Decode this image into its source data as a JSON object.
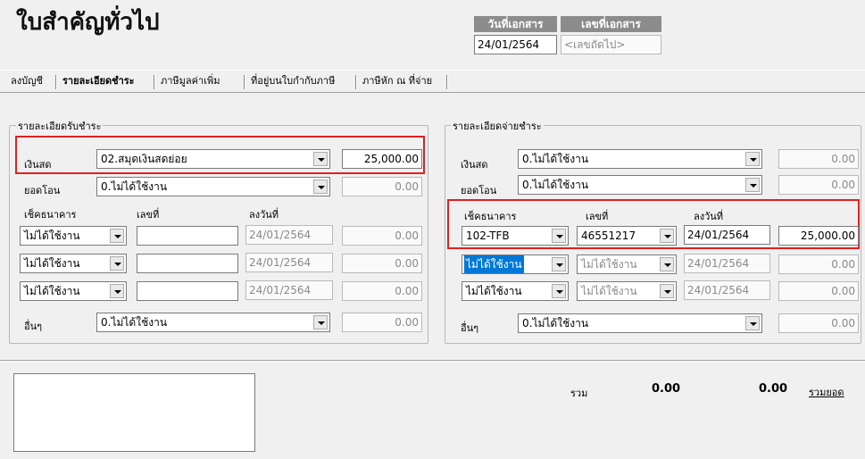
{
  "title": "ใบสำคัญทั่วไป",
  "doc": {
    "date_label": "วันที่เอกสาร",
    "no_label": "เลขที่เอกสาร",
    "date_value": "24/01/2564",
    "no_value": "<เลขถัดไป>"
  },
  "tabs": [
    "ลงบัญชี",
    "รายละเอียดชำระ",
    "ภาษีมูลค่าเพิ่ม",
    "ที่อยู่บนใบกำกับภาษี",
    "ภาษีหัก ณ ที่จ่าย"
  ],
  "receive": {
    "title": "รายละเอียดรับชำระ",
    "cash_label": "เงินสด",
    "cash_select": "02.สมุดเงินสดย่อย",
    "cash_amount": "25,000.00",
    "transfer_label": "ยอดโอน",
    "transfer_select": "0.ไม่ได้ใช้งาน",
    "transfer_amount": "0.00",
    "cheque_label": "เช็คธนาคาร",
    "no_label": "เลขที่",
    "date_label": "ลงวันที่",
    "cheques": [
      {
        "bank": "ไม่ได้ใช้งาน",
        "no": "",
        "date": "24/01/2564",
        "amount": "0.00"
      },
      {
        "bank": "ไม่ได้ใช้งาน",
        "no": "",
        "date": "24/01/2564",
        "amount": "0.00"
      },
      {
        "bank": "ไม่ได้ใช้งาน",
        "no": "",
        "date": "24/01/2564",
        "amount": "0.00"
      }
    ],
    "other_label": "อื่นๆ",
    "other_select": "0.ไม่ได้ใช้งาน",
    "other_amount": "0.00"
  },
  "pay": {
    "title": "รายละเอียดจ่ายชำระ",
    "cash_label": "เงินสด",
    "cash_select": "0.ไม่ได้ใช้งาน",
    "cash_amount": "0.00",
    "transfer_label": "ยอดโอน",
    "transfer_select": "0.ไม่ได้ใช้งาน",
    "transfer_amount": "0.00",
    "cheque_label": "เช็คธนาคาร",
    "no_label": "เลขที่",
    "date_label": "ลงวันที่",
    "cheques": [
      {
        "bank": "102-TFB",
        "no": "46551217",
        "date": "24/01/2564",
        "amount": "25,000.00"
      },
      {
        "bank": "ไม่ได้ใช้งาน",
        "no": "ไม่ได้ใช้งาน",
        "date": "24/01/2564",
        "amount": "0.00"
      },
      {
        "bank": "ไม่ได้ใช้งาน",
        "no": "ไม่ได้ใช้งาน",
        "date": "24/01/2564",
        "amount": "0.00"
      }
    ],
    "other_label": "อื่นๆ",
    "other_select": "0.ไม่ได้ใช้งาน",
    "other_amount": "0.00"
  },
  "footer": {
    "total_label": "รวม",
    "total_receive": "0.00",
    "total_pay": "0.00",
    "sum_link": "รวมยอด"
  },
  "colors": {
    "highlight": "#e02020",
    "selection": "#0078d7"
  }
}
